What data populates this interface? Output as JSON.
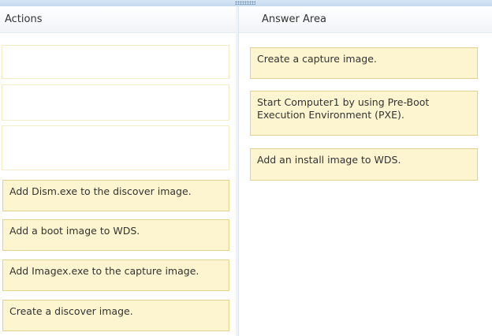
{
  "actions": {
    "header": "Actions",
    "items": [
      {
        "label": "Add Dism.exe to the discover image."
      },
      {
        "label": "Add a boot image to WDS."
      },
      {
        "label": "Add Imagex.exe to the capture image."
      },
      {
        "label": "Create a discover image."
      }
    ]
  },
  "answer_area": {
    "header": "Answer Area",
    "items": [
      {
        "label": "Create a capture image."
      },
      {
        "label": "Start Computer1 by using Pre-Boot Execution Environment (PXE)."
      },
      {
        "label": "Add an install image to WDS."
      }
    ]
  },
  "colors": {
    "item_fill": "#fdf5cf",
    "item_border": "#e2d48d",
    "header_strip": "#d6e6f5"
  }
}
